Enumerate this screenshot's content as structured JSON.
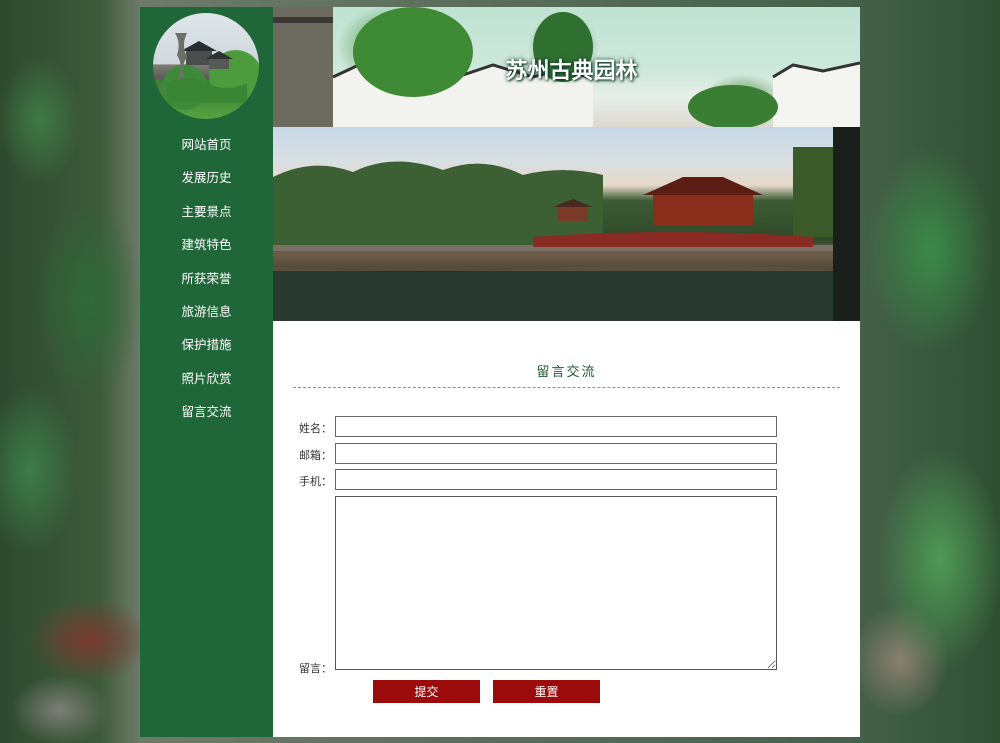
{
  "site": {
    "title": "苏州古典园林"
  },
  "nav": {
    "items": [
      {
        "label": "网站首页"
      },
      {
        "label": "发展历史"
      },
      {
        "label": "主要景点"
      },
      {
        "label": "建筑特色"
      },
      {
        "label": "所获荣誉"
      },
      {
        "label": "旅游信息"
      },
      {
        "label": "保护措施"
      },
      {
        "label": "照片欣赏"
      },
      {
        "label": "留言交流"
      }
    ]
  },
  "form": {
    "section_title": "留言交流",
    "name_label": "姓名：",
    "name_value": "",
    "email_label": "邮箱：",
    "email_value": "",
    "phone_label": "手机：",
    "phone_value": "",
    "message_label": "留言：",
    "message_value": "",
    "submit_label": "提交",
    "reset_label": "重置"
  },
  "colors": {
    "sidebar": "#1f6638",
    "button": "#9b0b0b",
    "title_text": "#1e5a33"
  }
}
